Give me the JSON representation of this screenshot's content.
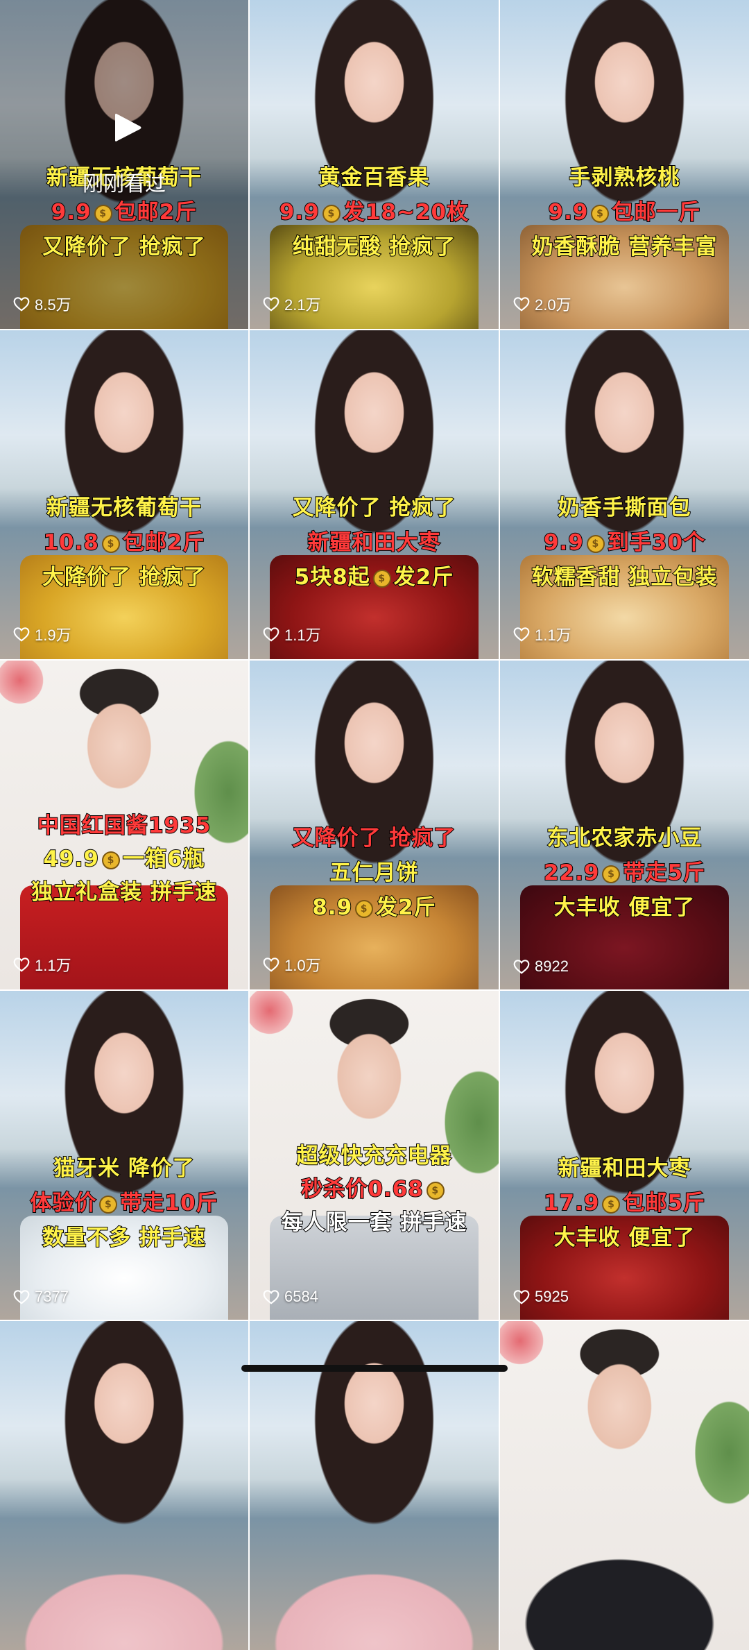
{
  "recently_viewed_label": "刚刚看过",
  "colors": {
    "caption_yellow": "#fff34a",
    "caption_red": "#ff3a3a",
    "coin": "#e9b72b"
  },
  "tiles": [
    {
      "type": "girl",
      "product": "raisin",
      "recent": true,
      "lines": [
        {
          "parts": [
            {
              "t": "新疆无核葡萄干",
              "c": "y"
            }
          ]
        },
        {
          "parts": [
            {
              "t": "9.9",
              "c": "r"
            },
            {
              "coin": true
            },
            {
              "t": "包邮2斤",
              "c": "r"
            }
          ]
        },
        {
          "parts": [
            {
              "t": "又降价了  抢疯了",
              "c": "y"
            }
          ]
        }
      ],
      "likes": "8.5万"
    },
    {
      "type": "girl",
      "product": "passion",
      "lines": [
        {
          "parts": [
            {
              "t": "黄金百香果",
              "c": "y"
            }
          ]
        },
        {
          "parts": [
            {
              "t": "9.9",
              "c": "r"
            },
            {
              "coin": true
            },
            {
              "t": "发18~20枚",
              "c": "r"
            }
          ]
        },
        {
          "parts": [
            {
              "t": "纯甜无酸  抢疯了",
              "c": "y"
            }
          ]
        }
      ],
      "likes": "2.1万"
    },
    {
      "type": "girl",
      "product": "walnut",
      "lines": [
        {
          "parts": [
            {
              "t": "手剥熟核桃",
              "c": "y"
            }
          ]
        },
        {
          "parts": [
            {
              "t": "9.9",
              "c": "r"
            },
            {
              "coin": true
            },
            {
              "t": "包邮一斤",
              "c": "r"
            }
          ]
        },
        {
          "parts": [
            {
              "t": "奶香酥脆  营养丰富",
              "c": "y"
            }
          ]
        }
      ],
      "likes": "2.0万"
    },
    {
      "type": "girl",
      "product": "raisin",
      "lines": [
        {
          "parts": [
            {
              "t": "新疆无核葡萄干",
              "c": "y"
            }
          ]
        },
        {
          "parts": [
            {
              "t": "10.8",
              "c": "r"
            },
            {
              "coin": true
            },
            {
              "t": "包邮2斤",
              "c": "r"
            }
          ]
        },
        {
          "parts": [
            {
              "t": "大降价了  抢疯了",
              "c": "y"
            }
          ]
        }
      ],
      "likes": "1.9万"
    },
    {
      "type": "girl",
      "product": "date",
      "lines": [
        {
          "parts": [
            {
              "t": "又降价了  抢疯了",
              "c": "y"
            }
          ]
        },
        {
          "parts": [
            {
              "t": "新疆和田大枣",
              "c": "r"
            }
          ]
        },
        {
          "parts": [
            {
              "t": "5块8起",
              "c": "y"
            },
            {
              "coin": true
            },
            {
              "t": "发2斤",
              "c": "y"
            }
          ]
        }
      ],
      "likes": "1.1万"
    },
    {
      "type": "girl",
      "product": "bread",
      "lines": [
        {
          "parts": [
            {
              "t": "奶香手撕面包",
              "c": "y"
            }
          ]
        },
        {
          "parts": [
            {
              "t": "9.9",
              "c": "r"
            },
            {
              "coin": true
            },
            {
              "t": "到手30个",
              "c": "r"
            }
          ]
        },
        {
          "parts": [
            {
              "t": "软糯香甜  独立包装",
              "c": "y"
            }
          ]
        }
      ],
      "likes": "1.1万"
    },
    {
      "type": "man",
      "product": "baijiu",
      "lines": [
        {
          "parts": [
            {
              "t": "中国红国酱1935",
              "c": "r"
            }
          ]
        },
        {
          "parts": [
            {
              "t": "49.9",
              "c": "y"
            },
            {
              "coin": true
            },
            {
              "t": "一箱6瓶",
              "c": "y"
            }
          ]
        },
        {
          "parts": [
            {
              "t": "独立礼盒装  拼手速",
              "c": "y"
            }
          ]
        }
      ],
      "likes": "1.1万"
    },
    {
      "type": "girl",
      "product": "mooncake",
      "lines": [
        {
          "parts": [
            {
              "t": "又降价了  抢疯了",
              "c": "r"
            }
          ]
        },
        {
          "parts": [
            {
              "t": "五仁月饼",
              "c": "y"
            }
          ]
        },
        {
          "parts": [
            {
              "t": "8.9",
              "c": "y"
            },
            {
              "coin": true
            },
            {
              "t": "发2斤",
              "c": "y"
            }
          ]
        }
      ],
      "likes": "1.0万"
    },
    {
      "type": "girl",
      "product": "bean",
      "lines": [
        {
          "parts": [
            {
              "t": "东北农家赤小豆",
              "c": "y"
            }
          ]
        },
        {
          "parts": [
            {
              "t": "22.9",
              "c": "r"
            },
            {
              "coin": true
            },
            {
              "t": "带走5斤",
              "c": "r"
            }
          ]
        },
        {
          "parts": [
            {
              "t": "大丰收  便宜了",
              "c": "y"
            }
          ]
        }
      ],
      "likes": "8922"
    },
    {
      "type": "girl",
      "product": "rice",
      "lines": [
        {
          "parts": [
            {
              "t": "猫牙米  降价了",
              "c": "y"
            }
          ]
        },
        {
          "parts": [
            {
              "t": "体验价",
              "c": "r"
            },
            {
              "coin": true
            },
            {
              "t": "带走10斤",
              "c": "r"
            }
          ]
        },
        {
          "parts": [
            {
              "t": "数量不多  拼手速",
              "c": "y"
            }
          ]
        }
      ],
      "likes": "7377"
    },
    {
      "type": "man",
      "product": "charger",
      "lines": [
        {
          "parts": [
            {
              "t": "超级快充充电器",
              "c": "y"
            }
          ]
        },
        {
          "parts": [
            {
              "t": "秒杀价0.68",
              "c": "r"
            },
            {
              "coin": true
            }
          ]
        },
        {
          "parts": [
            {
              "t": "每人限一套  拼手速",
              "c": "w"
            }
          ]
        }
      ],
      "likes": "6584"
    },
    {
      "type": "girl",
      "product": "date",
      "lines": [
        {
          "parts": [
            {
              "t": "新疆和田大枣",
              "c": "y"
            }
          ]
        },
        {
          "parts": [
            {
              "t": "17.9",
              "c": "r"
            },
            {
              "coin": true
            },
            {
              "t": "包邮5斤",
              "c": "r"
            }
          ]
        },
        {
          "parts": [
            {
              "t": "大丰收  便宜了",
              "c": "y"
            }
          ]
        }
      ],
      "likes": "5925"
    },
    {
      "type": "girl",
      "product": "none",
      "lines": [],
      "likes": ""
    },
    {
      "type": "girl",
      "product": "none",
      "lines": [],
      "likes": ""
    },
    {
      "type": "man",
      "product": "none",
      "lines": [],
      "likes": ""
    }
  ]
}
